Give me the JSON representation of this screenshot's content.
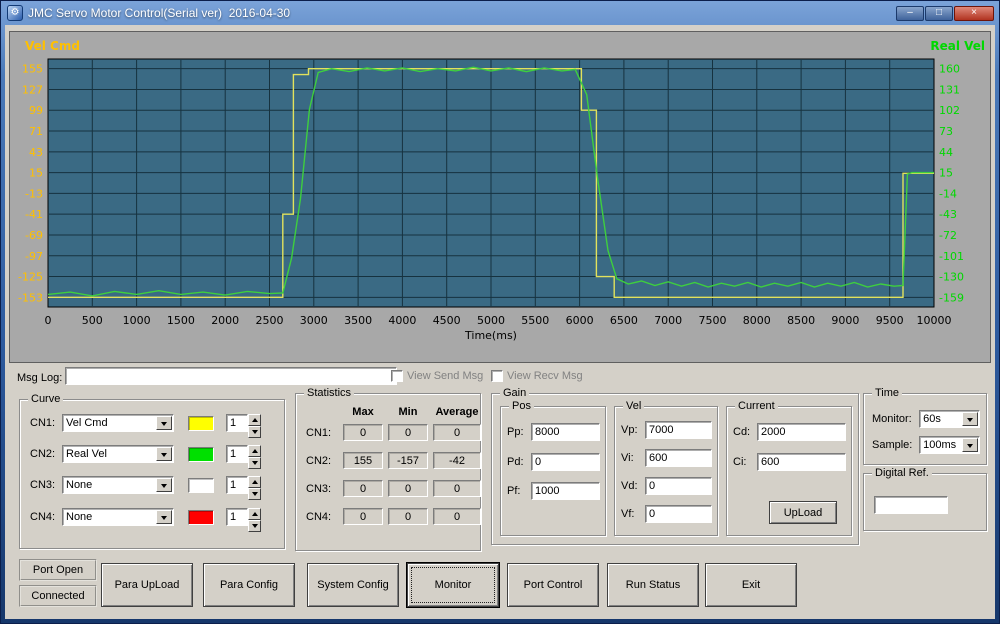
{
  "window": {
    "title": "JMC Servo Motor Control(Serial ver)  2016-04-30",
    "minimize_glyph": "–",
    "maximize_glyph": "□",
    "close_glyph": "×"
  },
  "chart": {
    "vel_cmd_label": "Vel Cmd",
    "real_vel_label": "Real Vel",
    "colors": {
      "panel_bg": "#a8a8a8",
      "plot_bg": "#3a6a84",
      "grid": "#16323f",
      "left_axis": "#ffc000",
      "right_axis": "#00d800",
      "x_axis_text": "#000000"
    }
  },
  "chart_data": {
    "type": "line",
    "xlabel": "Time(ms)",
    "xlim": [
      0,
      10000
    ],
    "ylim_left": [
      -166,
      168
    ],
    "x_ticks": [
      0,
      500,
      1000,
      1500,
      2000,
      2500,
      3000,
      3500,
      4000,
      4500,
      5000,
      5500,
      6000,
      6500,
      7000,
      7500,
      8000,
      8500,
      9000,
      9500,
      10000
    ],
    "left_ticks": [
      155,
      127,
      99,
      71,
      43,
      15,
      -13,
      -41,
      -69,
      -97,
      -125,
      -153
    ],
    "right_ticks": [
      160,
      131,
      102,
      73,
      44,
      15,
      -14,
      -43,
      -72,
      -101,
      -130,
      -159
    ],
    "grid": true,
    "series": [
      {
        "name": "Vel Cmd",
        "color": "#e2e25c",
        "points": [
          [
            0,
            -153
          ],
          [
            2650,
            -153
          ],
          [
            2650,
            -41
          ],
          [
            2770,
            -41
          ],
          [
            2770,
            147
          ],
          [
            2940,
            147
          ],
          [
            2940,
            155
          ],
          [
            6020,
            155
          ],
          [
            6020,
            99
          ],
          [
            6190,
            99
          ],
          [
            6190,
            -125
          ],
          [
            6390,
            -125
          ],
          [
            6390,
            -153
          ],
          [
            9650,
            -153
          ],
          [
            9650,
            14
          ],
          [
            10000,
            14
          ]
        ]
      },
      {
        "name": "Real Vel",
        "color": "#3ecf3e",
        "points": [
          [
            0,
            -149
          ],
          [
            250,
            -146
          ],
          [
            500,
            -151
          ],
          [
            750,
            -145
          ],
          [
            1000,
            -149
          ],
          [
            1250,
            -144
          ],
          [
            1500,
            -149
          ],
          [
            1750,
            -146
          ],
          [
            2000,
            -150
          ],
          [
            2250,
            -145
          ],
          [
            2500,
            -148
          ],
          [
            2650,
            -147
          ],
          [
            2750,
            -100
          ],
          [
            2850,
            -20
          ],
          [
            2950,
            100
          ],
          [
            3050,
            150
          ],
          [
            3200,
            155
          ],
          [
            3400,
            151
          ],
          [
            3600,
            156
          ],
          [
            3800,
            152
          ],
          [
            4000,
            156
          ],
          [
            4200,
            151
          ],
          [
            4400,
            155
          ],
          [
            4600,
            152
          ],
          [
            4800,
            157
          ],
          [
            5000,
            152
          ],
          [
            5200,
            156
          ],
          [
            5400,
            151
          ],
          [
            5600,
            156
          ],
          [
            5800,
            152
          ],
          [
            5950,
            154
          ],
          [
            6080,
            120
          ],
          [
            6200,
            10
          ],
          [
            6320,
            -90
          ],
          [
            6420,
            -128
          ],
          [
            6550,
            -135
          ],
          [
            6700,
            -131
          ],
          [
            6850,
            -137
          ],
          [
            7000,
            -132
          ],
          [
            7150,
            -138
          ],
          [
            7300,
            -133
          ],
          [
            7450,
            -139
          ],
          [
            7600,
            -134
          ],
          [
            7750,
            -138
          ],
          [
            7900,
            -133
          ],
          [
            8050,
            -139
          ],
          [
            8200,
            -134
          ],
          [
            8350,
            -138
          ],
          [
            8500,
            -133
          ],
          [
            8650,
            -139
          ],
          [
            8800,
            -134
          ],
          [
            8950,
            -138
          ],
          [
            9100,
            -133
          ],
          [
            9250,
            -139
          ],
          [
            9400,
            -135
          ],
          [
            9550,
            -138
          ],
          [
            9650,
            -137
          ],
          [
            9700,
            13
          ],
          [
            9750,
            15
          ],
          [
            10000,
            15
          ]
        ]
      }
    ]
  },
  "msg_log": {
    "label": "Msg Log:",
    "value": "",
    "send_checkbox": "View Send Msg",
    "recv_checkbox": "View Recv Msg"
  },
  "curve": {
    "title": "Curve",
    "rows": [
      {
        "label": "CN1:",
        "value": "Vel Cmd",
        "color": "#ffff00",
        "width_value": "1"
      },
      {
        "label": "CN2:",
        "value": "Real Vel",
        "color": "#00e000",
        "width_value": "1"
      },
      {
        "label": "CN3:",
        "value": "None",
        "color": "#ffffff",
        "width_value": "1"
      },
      {
        "label": "CN4:",
        "value": "None",
        "color": "#ff0000",
        "width_value": "1"
      }
    ]
  },
  "statistics": {
    "title": "Statistics",
    "headers": [
      "Max",
      "Min",
      "Average"
    ],
    "rows": [
      {
        "label": "CN1:",
        "max": "0",
        "min": "0",
        "avg": "0"
      },
      {
        "label": "CN2:",
        "max": "155",
        "min": "-157",
        "avg": "-42"
      },
      {
        "label": "CN3:",
        "max": "0",
        "min": "0",
        "avg": "0"
      },
      {
        "label": "CN4:",
        "max": "0",
        "min": "0",
        "avg": "0"
      }
    ]
  },
  "gain": {
    "title": "Gain",
    "pos": {
      "title": "Pos",
      "fields": [
        {
          "label": "Pp:",
          "value": "8000"
        },
        {
          "label": "Pd:",
          "value": "0"
        },
        {
          "label": "Pf:",
          "value": "1000"
        }
      ]
    },
    "vel": {
      "title": "Vel",
      "fields": [
        {
          "label": "Vp:",
          "value": "7000"
        },
        {
          "label": "Vi:",
          "value": "600"
        },
        {
          "label": "Vd:",
          "value": "0"
        },
        {
          "label": "Vf:",
          "value": "0"
        }
      ]
    },
    "current": {
      "title": "Current",
      "fields": [
        {
          "label": "Cd:",
          "value": "2000"
        },
        {
          "label": "Ci:",
          "value": "600"
        }
      ],
      "upload_label": "UpLoad"
    }
  },
  "time": {
    "title": "Time",
    "monitor_label": "Monitor:",
    "monitor_value": "60s",
    "sample_label": "Sample:",
    "sample_value": "100ms"
  },
  "digital_ref": {
    "title": "Digital Ref.",
    "value": ""
  },
  "footer": {
    "port_open": "Port Open",
    "connected": "Connected",
    "buttons": [
      "Para UpLoad",
      "Para Config",
      "System Config",
      "Monitor",
      "Port Control",
      "Run Status",
      "Exit"
    ]
  }
}
